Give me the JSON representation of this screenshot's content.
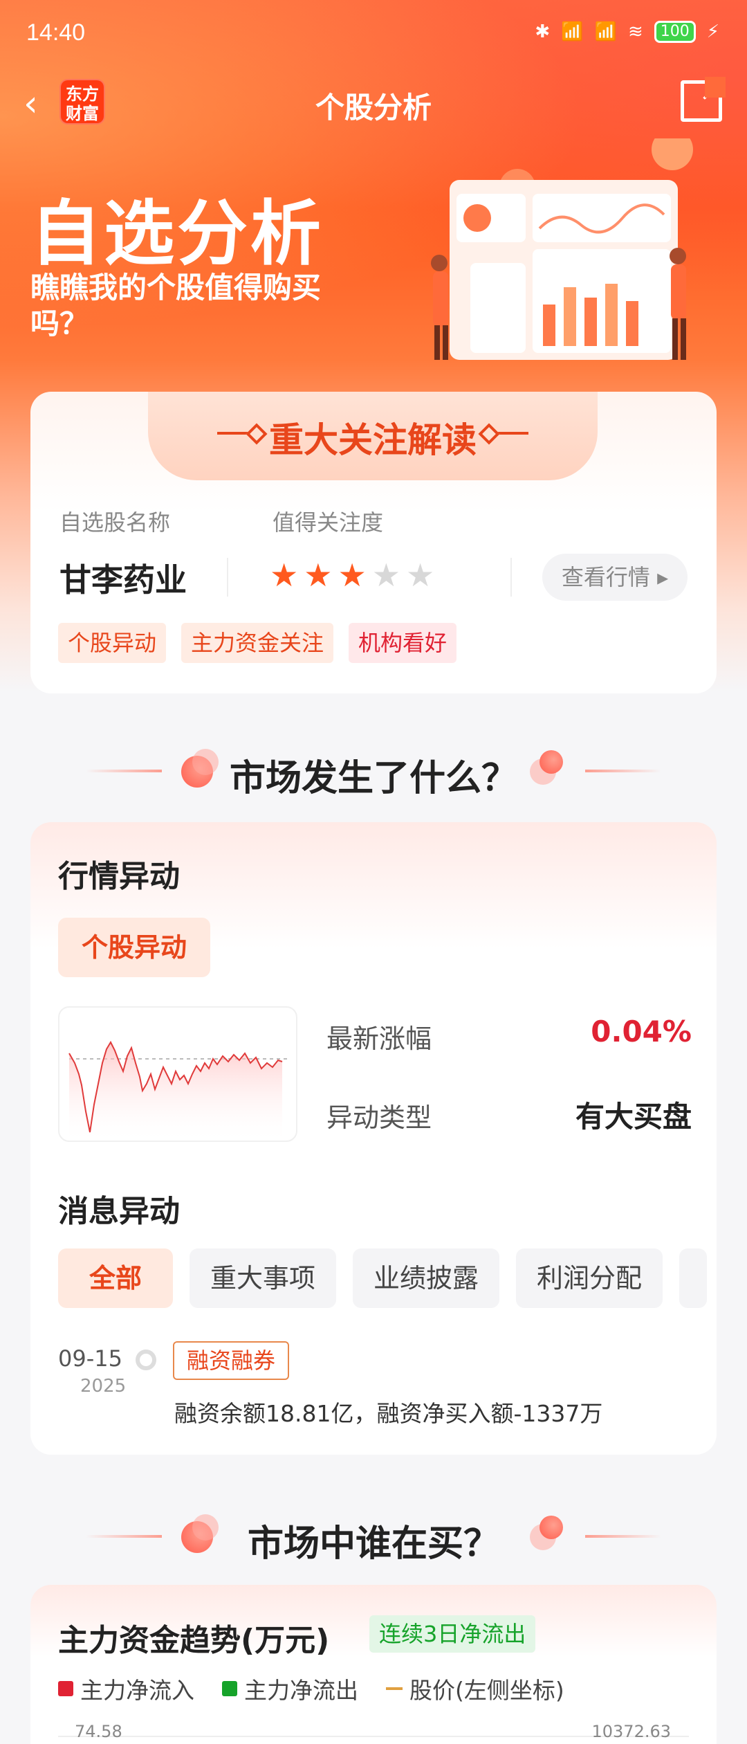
{
  "status_bar": {
    "time": "14:40",
    "network": "4G 4G",
    "battery": "100"
  },
  "nav": {
    "title": "个股分析",
    "logo_text": "东方财富",
    "back_icon": "chevron-left-icon",
    "share_icon": "share-icon"
  },
  "banner": {
    "title": "自选分析",
    "subtitle": "瞧瞧我的个股值得购买吗？"
  },
  "focus_card": {
    "header": "重大关注解读",
    "name_label": "自选股名称",
    "attention_label": "值得关注度",
    "stock_name": "甘李药业",
    "rating": 3,
    "rating_max": 5,
    "quote_button": "查看行情",
    "tags": [
      "个股异动",
      "主力资金关注",
      "机构看好"
    ]
  },
  "section_market": {
    "title": "市场发生了什么？"
  },
  "quote_change": {
    "title": "行情异动",
    "pill": "个股异动",
    "latest_change_label": "最新涨幅",
    "latest_change_value": "0.04%",
    "type_label": "异动类型",
    "type_value": "有大买盘"
  },
  "news": {
    "title": "消息异动",
    "filters": [
      "全部",
      "重大事项",
      "业绩披露",
      "利润分配"
    ],
    "items": [
      {
        "date": "09-15",
        "year": "2025",
        "tag": "融资融券",
        "text": "融资余额18.81亿，融资净买入额-1337万"
      }
    ]
  },
  "section_buyers": {
    "title": "市场中谁在买？"
  },
  "fund_trend": {
    "title": "主力资金趋势(万元)",
    "badge": "连续3日净流出",
    "legend": [
      "主力净流入",
      "主力净流出",
      "股价(左侧坐标)"
    ],
    "axis_left_top": "74.58",
    "axis_right_top": "10372.63"
  },
  "colors": {
    "accent": "#ff5a1f",
    "up": "#e02233",
    "down": "#16a32a",
    "price": "#e0a040"
  }
}
